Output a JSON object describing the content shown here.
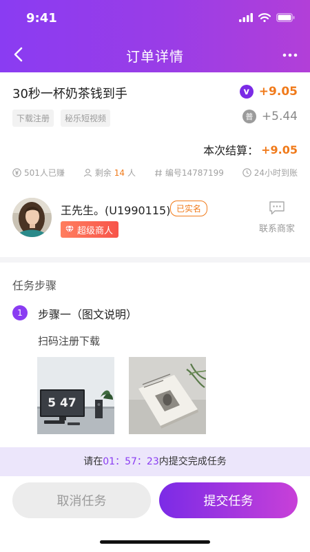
{
  "status_bar": {
    "time": "9:41"
  },
  "nav": {
    "title": "订单详情"
  },
  "task": {
    "title": "30秒一杯奶茶钱到手",
    "tags": [
      "下载注册",
      "秘乐短视频"
    ],
    "rewards": [
      {
        "badge": "v",
        "amount": "+9.05",
        "color": "#f07a1a"
      },
      {
        "badge": "普",
        "amount": "+5.44",
        "color": "#888888"
      }
    ],
    "settle_label": "本次结算：",
    "settle_amount": "+9.05",
    "stats": {
      "earned": "501人已赚",
      "remaining_prefix": "剩余",
      "remaining_count": "14",
      "remaining_suffix": "人",
      "serial": "编号14787199",
      "arrival": "24小时到账"
    }
  },
  "merchant": {
    "name": "王先生。(U1990115)",
    "verified": "已实名",
    "level": "超级商人",
    "contact": "联系商家"
  },
  "steps": {
    "title": "任务步骤",
    "items": [
      {
        "number": "1",
        "title": "步骤一（图文说明）",
        "description": "扫码注册下载"
      }
    ],
    "image1_text": "5 47"
  },
  "deadline": {
    "prefix": "请在",
    "h": "01",
    "sep1": "：",
    "m": "57",
    "sep2": "：",
    "s": "23",
    "suffix": "内提交完成任务"
  },
  "footer": {
    "cancel": "取消任务",
    "submit": "提交任务"
  },
  "colors": {
    "brand": "#8a3cf2",
    "accent": "#f07a1a"
  }
}
